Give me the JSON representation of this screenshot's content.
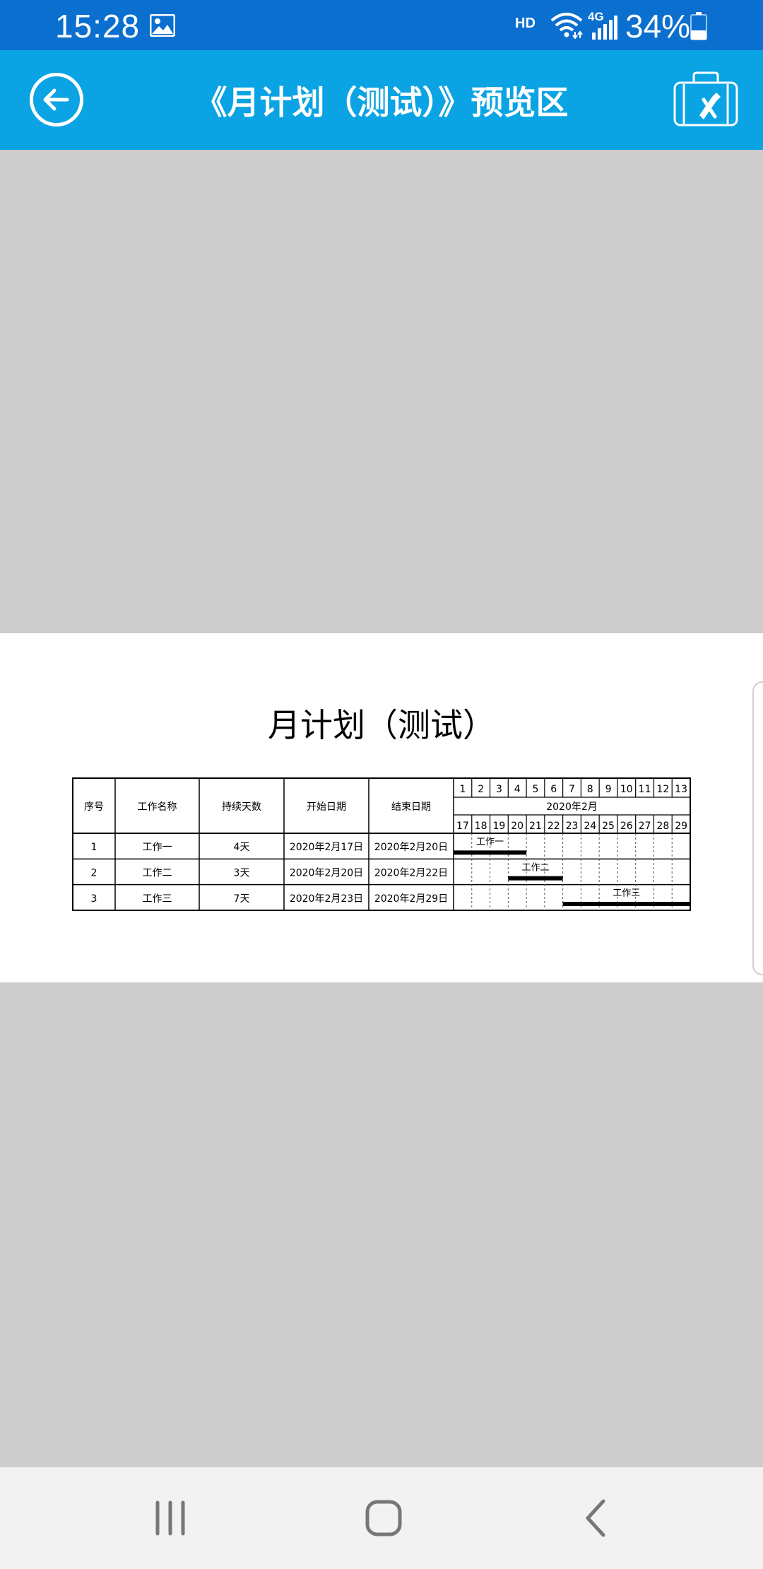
{
  "status_bar": {
    "time": "15:28",
    "hd_label": "HD",
    "network_label": "4G",
    "battery_percent": "34%",
    "battery_level": 0.34,
    "icons": [
      "image-icon",
      "wifi-icon",
      "signal-icon",
      "battery-icon"
    ]
  },
  "header": {
    "title": "《月计划（测试）》预览区",
    "back_icon": "arrow-left-icon",
    "toolbox_icon": "toolbox-icon",
    "color": "#0aa3e3"
  },
  "document": {
    "title": "月计划（测试）",
    "columns": [
      "序号",
      "工作名称",
      "持续天数",
      "开始日期",
      "结束日期"
    ],
    "week_numbers": [
      "1",
      "2",
      "3",
      "4",
      "5",
      "6",
      "7",
      "8",
      "9",
      "10",
      "11",
      "12",
      "13"
    ],
    "month_label": "2020年2月",
    "days": [
      "17",
      "18",
      "19",
      "20",
      "21",
      "22",
      "23",
      "24",
      "25",
      "26",
      "27",
      "28",
      "29"
    ],
    "rows": [
      {
        "index": "1",
        "name": "工作一",
        "duration": "4天",
        "start": "2020年2月17日",
        "end": "2020年2月20日",
        "bar_start_day": 17,
        "bar_end_day": 20,
        "bar_label": "工作一"
      },
      {
        "index": "2",
        "name": "工作二",
        "duration": "3天",
        "start": "2020年2月20日",
        "end": "2020年2月22日",
        "bar_start_day": 20,
        "bar_end_day": 22,
        "bar_label": "工作二"
      },
      {
        "index": "3",
        "name": "工作三",
        "duration": "7天",
        "start": "2020年2月23日",
        "end": "2020年2月29日",
        "bar_start_day": 23,
        "bar_end_day": 29,
        "bar_label": "工作三"
      }
    ]
  },
  "nav_bar": {
    "buttons": [
      "recent-apps-icon",
      "home-icon",
      "back-icon"
    ]
  }
}
